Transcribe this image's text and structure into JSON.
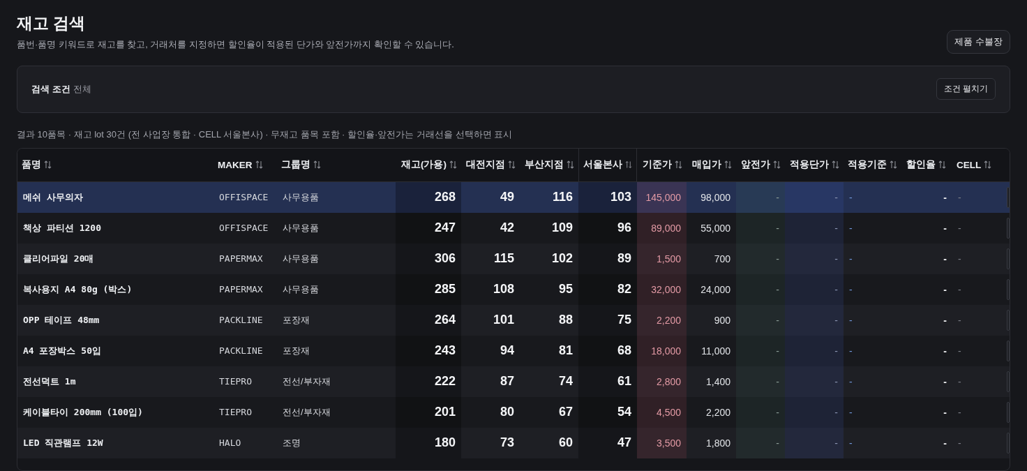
{
  "header": {
    "title": "재고 검색",
    "subtitle": "품번·품명 키워드로 재고를 찾고, 거래처를 지정하면 할인율이 적용된 단가와 앞전가까지 확인할 수 있습니다.",
    "button": "제품 수불장"
  },
  "filter": {
    "label": "검색 조건",
    "value": "전체",
    "button": "조건 펼치기"
  },
  "summary": "결과 10품목 · 재고 lot 30건 (전 사업장 통합 · CELL 서울본사) · 무재고 품목 포함 · 할인율·앞전가는 거래선을 선택하면 표시",
  "table": {
    "columns": [
      "품명",
      "MAKER",
      "그룹명",
      "재고(가용)",
      "대전지점",
      "부산지점",
      "서울본사",
      "기준가",
      "매입가",
      "앞전가",
      "적용단가",
      "적용기준",
      "할인율",
      "CELL"
    ],
    "rows": [
      {
        "selected": true,
        "cells": [
          "메쉬 사무의자",
          "OFFISPACE",
          "사무용품",
          "268",
          "49",
          "116",
          "103",
          "145,000",
          "98,000",
          "-",
          "-",
          "-",
          "-",
          "-"
        ]
      },
      {
        "selected": false,
        "cells": [
          "책상 파티션 1200",
          "OFFISPACE",
          "사무용품",
          "247",
          "42",
          "109",
          "96",
          "89,000",
          "55,000",
          "-",
          "-",
          "-",
          "-",
          "-"
        ]
      },
      {
        "selected": false,
        "cells": [
          "클리어파일 20매",
          "PAPERMAX",
          "사무용품",
          "306",
          "115",
          "102",
          "89",
          "1,500",
          "700",
          "-",
          "-",
          "-",
          "-",
          "-"
        ]
      },
      {
        "selected": false,
        "cells": [
          "복사용지 A4 80g (박스)",
          "PAPERMAX",
          "사무용품",
          "285",
          "108",
          "95",
          "82",
          "32,000",
          "24,000",
          "-",
          "-",
          "-",
          "-",
          "-"
        ]
      },
      {
        "selected": false,
        "cells": [
          "OPP 테이프 48mm",
          "PACKLINE",
          "포장재",
          "264",
          "101",
          "88",
          "75",
          "2,200",
          "900",
          "-",
          "-",
          "-",
          "-",
          "-"
        ]
      },
      {
        "selected": false,
        "cells": [
          "A4 포장박스 50입",
          "PACKLINE",
          "포장재",
          "243",
          "94",
          "81",
          "68",
          "18,000",
          "11,000",
          "-",
          "-",
          "-",
          "-",
          "-"
        ]
      },
      {
        "selected": false,
        "cells": [
          "전선덕트 1m",
          "TIEPRO",
          "전선/부자재",
          "222",
          "87",
          "74",
          "61",
          "2,800",
          "1,400",
          "-",
          "-",
          "-",
          "-",
          "-"
        ]
      },
      {
        "selected": false,
        "cells": [
          "케이블타이 200mm (100입)",
          "TIEPRO",
          "전선/부자재",
          "201",
          "80",
          "67",
          "54",
          "4,500",
          "2,200",
          "-",
          "-",
          "-",
          "-",
          "-"
        ]
      },
      {
        "selected": false,
        "cells": [
          "LED 직관램프 12W",
          "HALO",
          "조명",
          "180",
          "73",
          "60",
          "47",
          "3,500",
          "1,800",
          "-",
          "-",
          "-",
          "-",
          "-"
        ]
      }
    ]
  }
}
